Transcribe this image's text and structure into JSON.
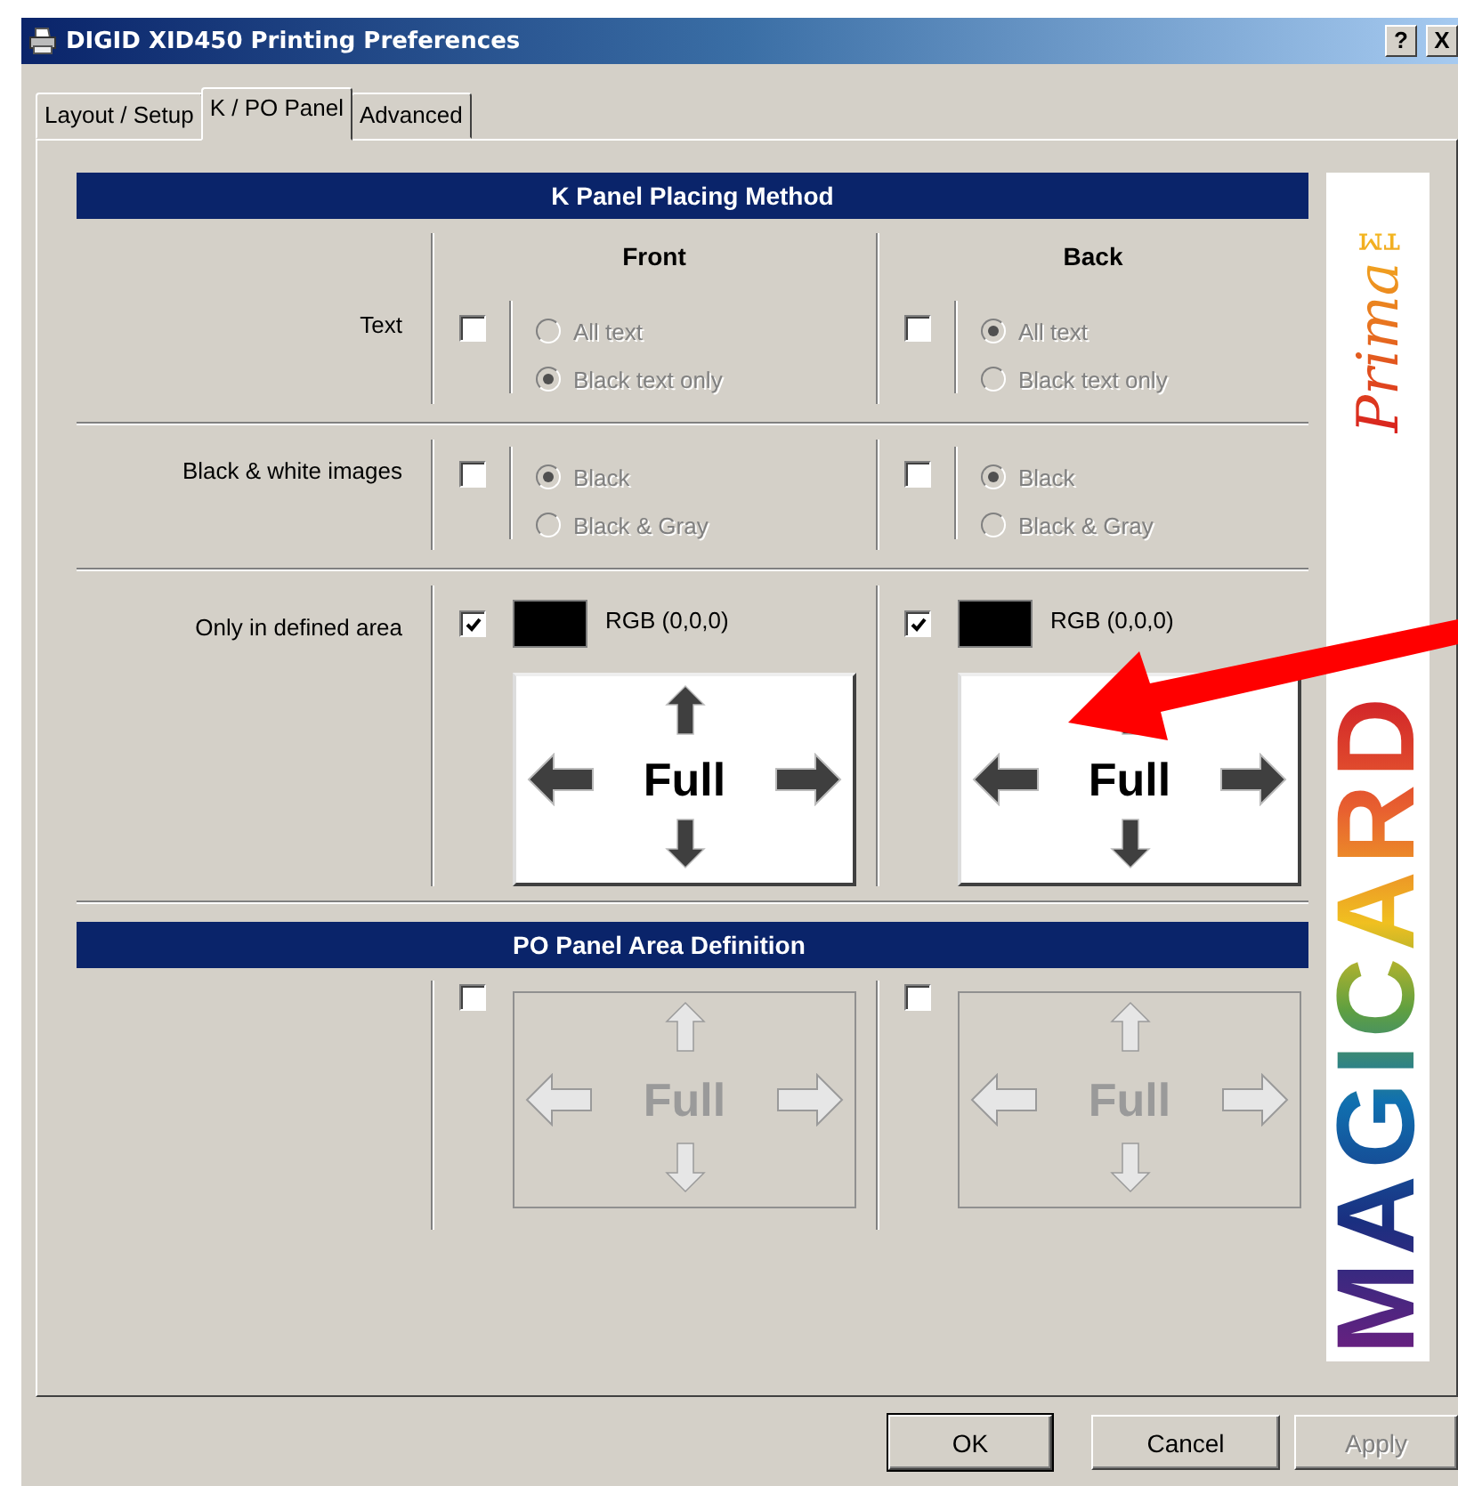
{
  "window": {
    "title": "DIGID XID450 Printing Preferences",
    "help_button": "?",
    "close_button": "X"
  },
  "tabs": [
    {
      "label": "Layout / Setup",
      "selected": false
    },
    {
      "label": "K / PO Panel",
      "selected": true
    },
    {
      "label": "Advanced",
      "selected": false
    }
  ],
  "k_panel": {
    "title": "K Panel Placing Method",
    "columns": [
      "Front",
      "Back"
    ],
    "rows": [
      {
        "label": "Text",
        "kind": "radio",
        "sides": [
          {
            "checked": false,
            "options": [
              {
                "label": "All text",
                "selected": false,
                "disabled": true
              },
              {
                "label": "Black text only",
                "selected": true,
                "disabled": true
              }
            ]
          },
          {
            "checked": false,
            "options": [
              {
                "label": "All text",
                "selected": true,
                "disabled": true
              },
              {
                "label": "Black text only",
                "selected": false,
                "disabled": true
              }
            ]
          }
        ]
      },
      {
        "label": "Black & white images",
        "kind": "radio",
        "sides": [
          {
            "checked": false,
            "options": [
              {
                "label": "Black",
                "selected": true,
                "disabled": true
              },
              {
                "label": "Black & Gray",
                "selected": false,
                "disabled": true
              }
            ]
          },
          {
            "checked": false,
            "options": [
              {
                "label": "Black",
                "selected": true,
                "disabled": true
              },
              {
                "label": "Black & Gray",
                "selected": false,
                "disabled": true
              }
            ]
          }
        ]
      },
      {
        "label": "Only in defined area",
        "kind": "area",
        "sides": [
          {
            "checked": true,
            "color": "#000000",
            "color_label": "RGB (0,0,0)",
            "preview": {
              "label": "Full",
              "disabled": false
            }
          },
          {
            "checked": true,
            "color": "#000000",
            "color_label": "RGB (0,0,0)",
            "preview": {
              "label": "Full",
              "disabled": false
            }
          }
        ]
      }
    ]
  },
  "po_panel": {
    "title": "PO Panel Area Definition",
    "sides": [
      {
        "checked": false,
        "preview": {
          "label": "Full",
          "disabled": true
        }
      },
      {
        "checked": false,
        "preview": {
          "label": "Full",
          "disabled": true
        }
      }
    ]
  },
  "brand": {
    "tagline": "Prima™",
    "name": "MAGICARD"
  },
  "buttons": [
    {
      "label": "OK",
      "default": true,
      "disabled": false
    },
    {
      "label": "Cancel",
      "default": false,
      "disabled": false
    },
    {
      "label": "Apply",
      "default": false,
      "disabled": true
    }
  ]
}
